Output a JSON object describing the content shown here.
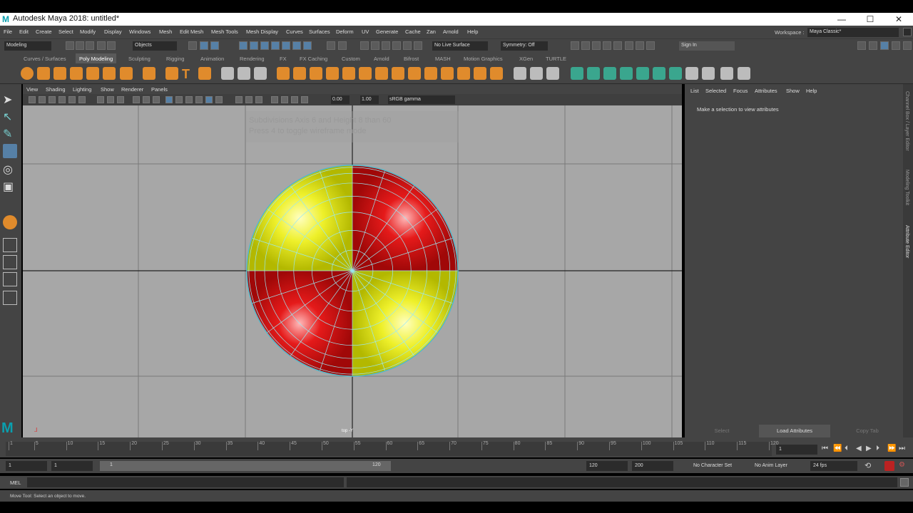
{
  "window": {
    "title": "Autodesk Maya 2018: untitled*",
    "minimize": "—",
    "maximize": "☐",
    "close": "✕"
  },
  "menu": [
    "File",
    "Edit",
    "Create",
    "Select",
    "Modify",
    "Display",
    "Windows",
    "Mesh",
    "Edit Mesh",
    "Mesh Tools",
    "Mesh Display",
    "Curves",
    "Surfaces",
    "Deform",
    "UV",
    "Generate",
    "Cache",
    "Zan",
    "Arnold",
    "Help"
  ],
  "workspace": {
    "label": "Workspace :",
    "value": "Maya Classic*"
  },
  "status": {
    "mode": "Modeling",
    "selection": "Objects",
    "live_surface": "No Live Surface",
    "symmetry": "Symmetry: Off",
    "sign_in": "Sign In"
  },
  "shelf_tabs": [
    "Curves / Surfaces",
    "Poly Modeling",
    "Sculpting",
    "Rigging",
    "Animation",
    "Rendering",
    "FX",
    "FX Caching",
    "Custom",
    "Arnold",
    "Bifrost",
    "MASH",
    "Motion Graphics",
    "XGen",
    "TURTLE"
  ],
  "active_shelf": "Poly Modeling",
  "viewport_menu": [
    "View",
    "Shading",
    "Lighting",
    "Show",
    "Renderer",
    "Panels"
  ],
  "viewport_toolbar": {
    "exposure": "0.00",
    "gamma": "1.00",
    "color_space": "sRGB gamma"
  },
  "viewport": {
    "camera_label": "top -Y",
    "hud_line1": "Subdivisions Axis 6 and Height 8 than 60",
    "hud_line2": "Press 4 to toggle wireframe mode"
  },
  "attribute_editor": {
    "menu": [
      "List",
      "Selected",
      "Focus",
      "Attributes",
      "Show",
      "Help"
    ],
    "message": "Make a selection to view attributes",
    "buttons": [
      "Select",
      "Load Attributes",
      "Copy Tab"
    ]
  },
  "side_tabs": [
    "Channel Box / Layer Editor",
    "Modeling Toolkit",
    "Attribute Editor"
  ],
  "timeline": {
    "ticks": [
      "1",
      "5",
      "10",
      "15",
      "20",
      "25",
      "30",
      "35",
      "40",
      "45",
      "50",
      "55",
      "60",
      "65",
      "70",
      "75",
      "80",
      "85",
      "90",
      "95",
      "100",
      "105",
      "110",
      "115",
      "120"
    ],
    "current_frame": "1"
  },
  "range": {
    "start": "1",
    "start2": "1",
    "slider_start": "1",
    "slider_end": "120",
    "end": "120",
    "end2": "200",
    "character_set": "No Character Set",
    "anim_layer": "No Anim Layer",
    "fps": "24 fps"
  },
  "command": {
    "lang": "MEL"
  },
  "help_line": "Move Tool: Select an object to move.",
  "colors": {
    "yellow": "#e8ea1a",
    "red": "#d80f0f",
    "wire": "#7fe0ef"
  }
}
